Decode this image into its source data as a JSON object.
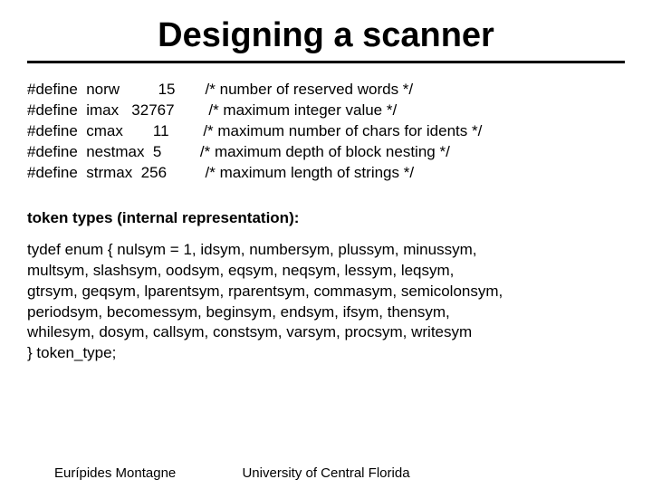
{
  "title": "Designing a scanner",
  "defines": [
    {
      "kw": "#define",
      "name": "norw",
      "val": "15",
      "comment": "/* number of reserved words */",
      "namepad": 10,
      "valpad": 5,
      "gap": 7
    },
    {
      "kw": "#define",
      "name": "imax",
      "val": "32767",
      "comment": "/* maximum integer value */",
      "namepad": 7,
      "valpad": 5,
      "gap": 8
    },
    {
      "kw": "#define",
      "name": "cmax",
      "val": "11",
      "comment": "/* maximum number of chars for idents */",
      "namepad": 11,
      "valpad": 2,
      "gap": 8
    },
    {
      "kw": "#define",
      "name": "nestmax",
      "val": "5",
      "comment": "/* maximum depth of block nesting */",
      "namepad": 9,
      "valpad": 1,
      "gap": 9
    },
    {
      "kw": "#define",
      "name": "strmax",
      "val": "256",
      "comment": "/* maximum length of strings */",
      "namepad": 8,
      "valpad": 3,
      "gap": 9
    }
  ],
  "section_label": "token types (internal representation):",
  "enum_lines": [
    "tydef enum { nulsym = 1, idsym, numbersym, plussym, minussym,",
    "multsym,  slashsym, oodsym, eqsym, neqsym, lessym, leqsym,",
    "gtrsym, geqsym, lparentsym, rparentsym, commasym, semicolonsym,",
    "periodsym, becomessym, beginsym, endsym, ifsym, thensym,",
    "whilesym, dosym, callsym, constsym, varsym, procsym, writesym",
    "} token_type;"
  ],
  "footer": {
    "left": "Eurípides Montagne",
    "center": "University of Central Florida"
  }
}
